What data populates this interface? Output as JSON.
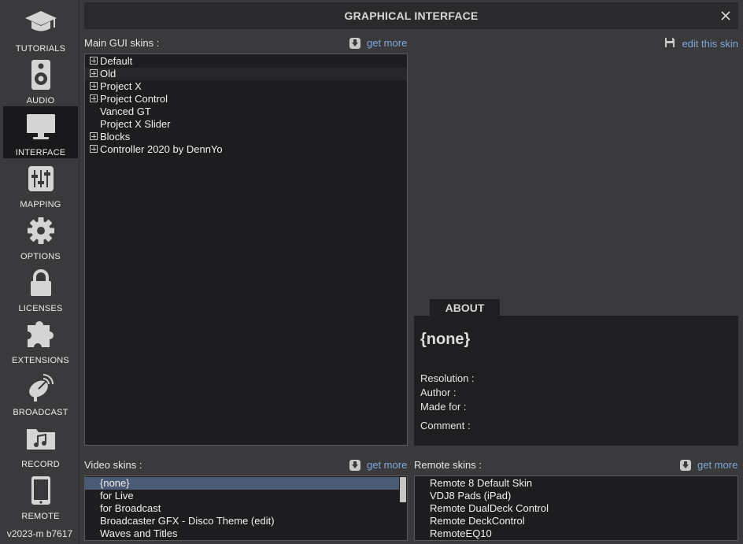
{
  "window": {
    "title": "GRAPHICAL INTERFACE"
  },
  "sidebar": {
    "items": [
      {
        "label": "TUTORIALS",
        "icon": "graduation-cap-icon"
      },
      {
        "label": "AUDIO",
        "icon": "speaker-icon"
      },
      {
        "label": "INTERFACE",
        "icon": "monitor-icon",
        "active": true
      },
      {
        "label": "MAPPING",
        "icon": "sliders-icon"
      },
      {
        "label": "OPTIONS",
        "icon": "gear-icon"
      },
      {
        "label": "LICENSES",
        "icon": "lock-icon"
      },
      {
        "label": "EXTENSIONS",
        "icon": "puzzle-icon"
      },
      {
        "label": "BROADCAST",
        "icon": "satellite-dish-icon"
      },
      {
        "label": "RECORD",
        "icon": "music-folder-icon"
      },
      {
        "label": "REMOTE",
        "icon": "tablet-icon"
      }
    ],
    "version": "v2023-m b7617"
  },
  "main_skins": {
    "label": "Main GUI skins :",
    "get_more": "get more",
    "items": [
      {
        "name": "Default",
        "expandable": true
      },
      {
        "name": "Old",
        "expandable": true
      },
      {
        "name": "Project X",
        "expandable": true
      },
      {
        "name": "Project Control",
        "expandable": true
      },
      {
        "name": "Vanced GT",
        "expandable": false
      },
      {
        "name": "Project X Slider",
        "expandable": false
      },
      {
        "name": "Blocks",
        "expandable": true
      },
      {
        "name": "Controller 2020 by DennYo",
        "expandable": true
      }
    ]
  },
  "edit_skin": {
    "label": "edit this skin",
    "icon": "save-icon"
  },
  "about": {
    "tab": "ABOUT",
    "name": "{none}",
    "resolution_label": "Resolution :",
    "author_label": "Author :",
    "made_for_label": "Made for :",
    "comment_label": "Comment :"
  },
  "video_skins": {
    "label": "Video skins :",
    "get_more": "get more",
    "items": [
      "{none}",
      "for Live",
      "for Broadcast",
      "Broadcaster GFX - Disco Theme (edit)",
      "Waves and Titles"
    ]
  },
  "remote_skins": {
    "label": "Remote skins :",
    "get_more": "get more",
    "items": [
      "Remote 8 Default Skin",
      "VDJ8 Pads (iPad)",
      "Remote DualDeck Control",
      "Remote DeckControl",
      "RemoteEQ10"
    ]
  },
  "colors": {
    "accent_link": "#7fa7d8",
    "selection": "#4b5a75",
    "panel": "#1d1d1f"
  }
}
